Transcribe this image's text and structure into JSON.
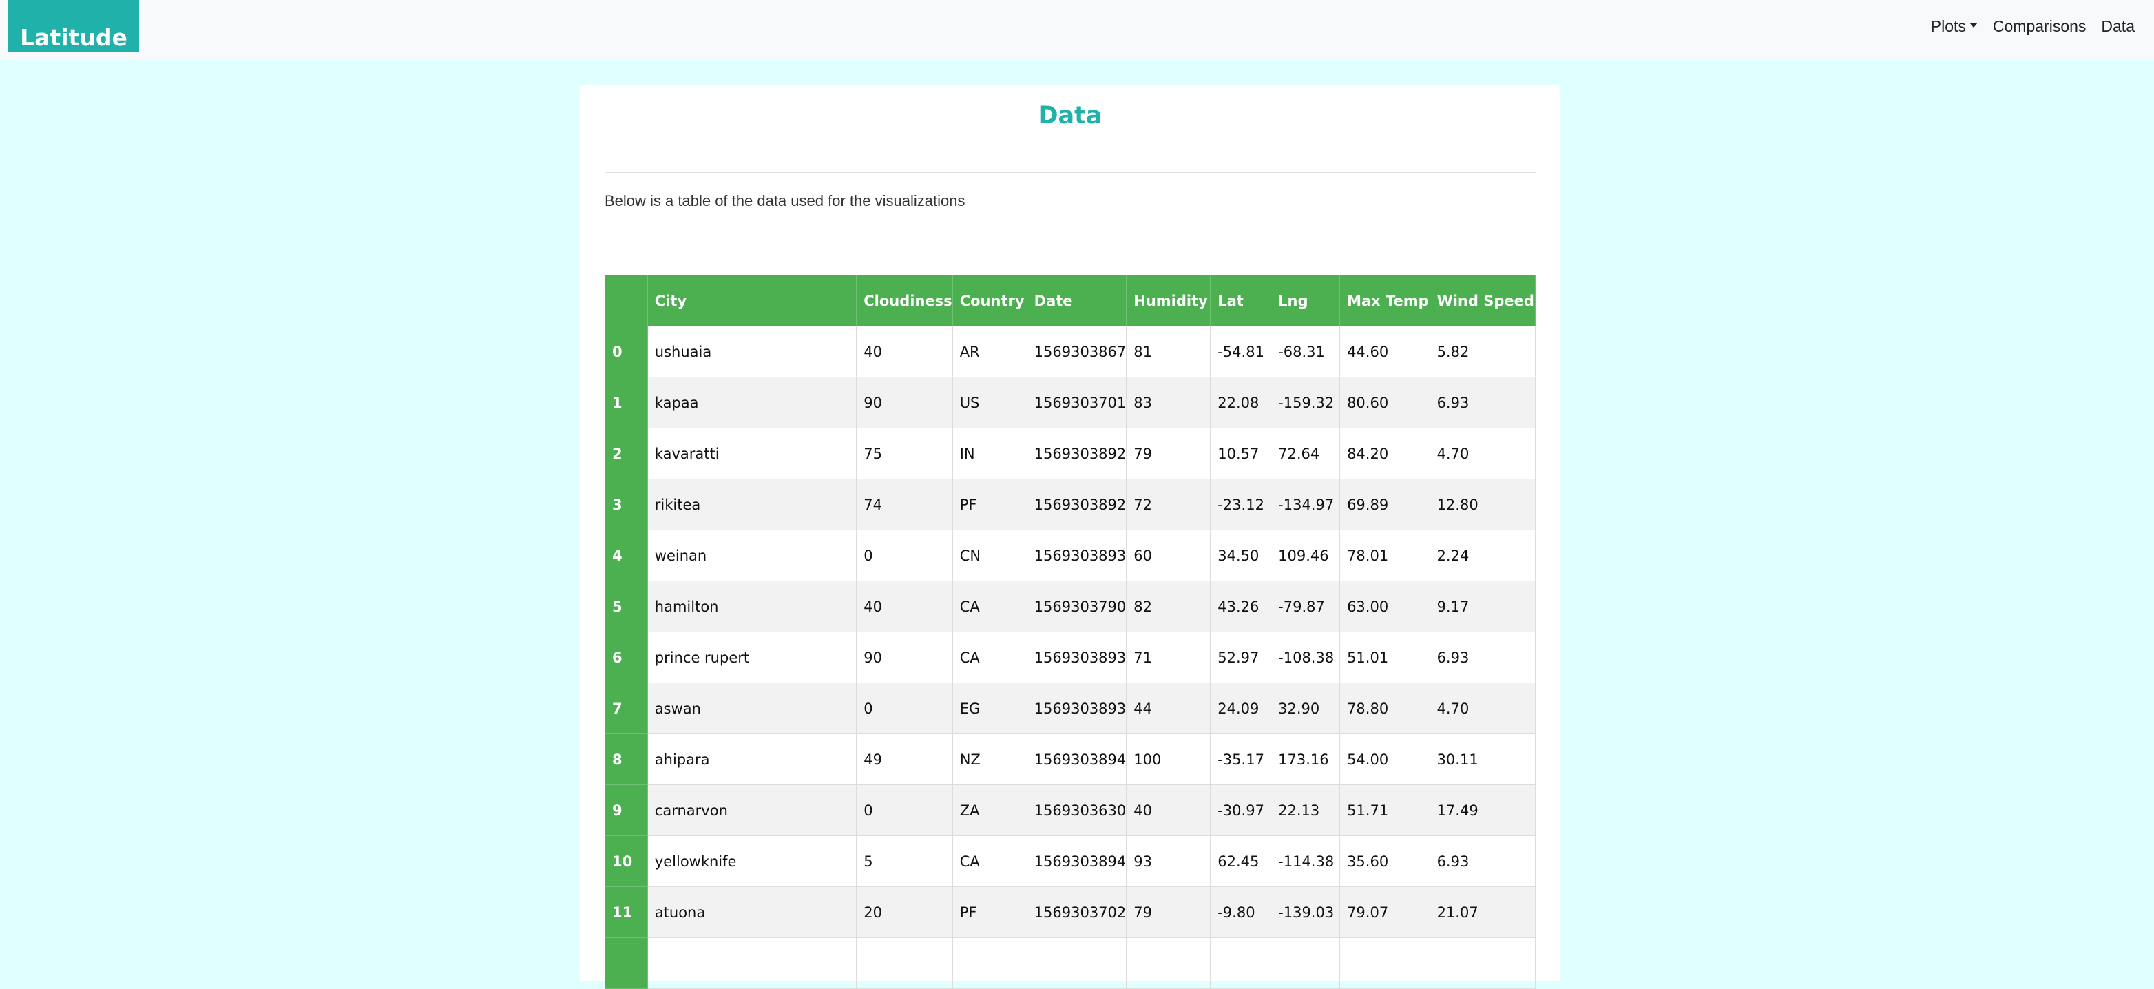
{
  "navbar": {
    "brand": "Latitude",
    "links": [
      {
        "label": "Plots",
        "dropdown": true
      },
      {
        "label": "Comparisons"
      },
      {
        "label": "Data"
      }
    ]
  },
  "page": {
    "title": "Data",
    "description": "Below is a table of the data used for the visualizations"
  },
  "table": {
    "columns": [
      "",
      "City",
      "Cloudiness",
      "Country",
      "Date",
      "Humidity",
      "Lat",
      "Lng",
      "Max Temp",
      "Wind Speed"
    ],
    "rows": [
      [
        "0",
        "ushuaia",
        "40",
        "AR",
        "1569303867",
        "81",
        "-54.81",
        "-68.31",
        "44.60",
        "5.82"
      ],
      [
        "1",
        "kapaa",
        "90",
        "US",
        "1569303701",
        "83",
        "22.08",
        "-159.32",
        "80.60",
        "6.93"
      ],
      [
        "2",
        "kavaratti",
        "75",
        "IN",
        "1569303892",
        "79",
        "10.57",
        "72.64",
        "84.20",
        "4.70"
      ],
      [
        "3",
        "rikitea",
        "74",
        "PF",
        "1569303892",
        "72",
        "-23.12",
        "-134.97",
        "69.89",
        "12.80"
      ],
      [
        "4",
        "weinan",
        "0",
        "CN",
        "1569303893",
        "60",
        "34.50",
        "109.46",
        "78.01",
        "2.24"
      ],
      [
        "5",
        "hamilton",
        "40",
        "CA",
        "1569303790",
        "82",
        "43.26",
        "-79.87",
        "63.00",
        "9.17"
      ],
      [
        "6",
        "prince rupert",
        "90",
        "CA",
        "1569303893",
        "71",
        "52.97",
        "-108.38",
        "51.01",
        "6.93"
      ],
      [
        "7",
        "aswan",
        "0",
        "EG",
        "1569303893",
        "44",
        "24.09",
        "32.90",
        "78.80",
        "4.70"
      ],
      [
        "8",
        "ahipara",
        "49",
        "NZ",
        "1569303894",
        "100",
        "-35.17",
        "173.16",
        "54.00",
        "30.11"
      ],
      [
        "9",
        "carnarvon",
        "0",
        "ZA",
        "1569303630",
        "40",
        "-30.97",
        "22.13",
        "51.71",
        "17.49"
      ],
      [
        "10",
        "yellowknife",
        "5",
        "CA",
        "1569303894",
        "93",
        "62.45",
        "-114.38",
        "35.60",
        "6.93"
      ],
      [
        "11",
        "atuona",
        "20",
        "PF",
        "1569303702",
        "79",
        "-9.80",
        "-139.03",
        "79.07",
        "21.07"
      ],
      [
        "",
        "",
        "",
        "",
        "",
        "",
        "",
        "",
        "",
        ""
      ]
    ]
  }
}
